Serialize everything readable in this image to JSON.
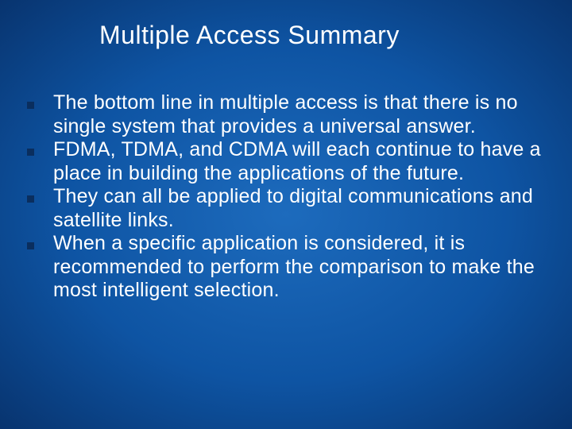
{
  "title": "Multiple Access Summary",
  "bullets": [
    "The bottom line in multiple access is that there is no single system that provides a universal answer.",
    "FDMA, TDMA, and CDMA will each continue to have a place in building the applications of the future.",
    "They can all be applied to digital communications and satellite links.",
    "When a specific application is considered, it is recommended to perform the comparison to make the most intelligent selection."
  ]
}
